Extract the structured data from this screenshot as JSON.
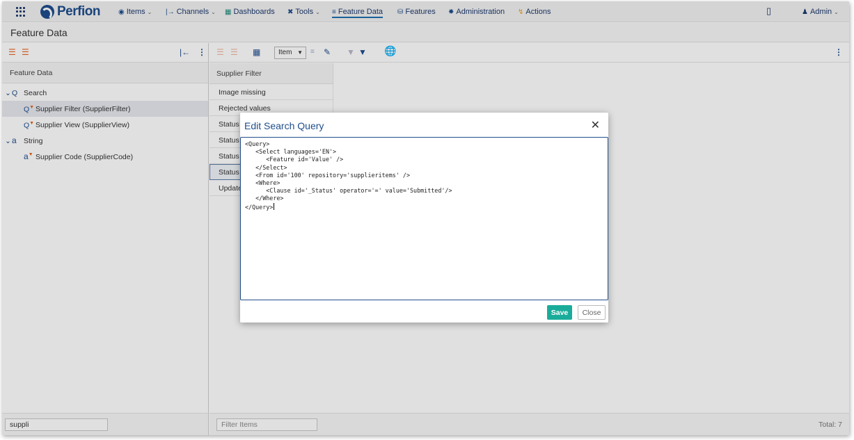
{
  "nav": {
    "logo": "Perfion",
    "items": [
      {
        "label": "Items",
        "icon": "items-icon",
        "caret": true
      },
      {
        "label": "Channels",
        "icon": "channels-icon",
        "caret": true
      },
      {
        "label": "Dashboards",
        "icon": "dashboards-icon",
        "caret": false
      },
      {
        "label": "Tools",
        "icon": "tools-icon",
        "caret": true
      },
      {
        "label": "Feature Data",
        "icon": "feature-data-icon",
        "caret": false
      },
      {
        "label": "Features",
        "icon": "features-icon",
        "caret": false
      },
      {
        "label": "Administration",
        "icon": "administration-icon",
        "caret": false
      },
      {
        "label": "Actions",
        "icon": "actions-icon",
        "caret": false
      }
    ],
    "user": "Admin"
  },
  "page": {
    "title": "Feature Data"
  },
  "left": {
    "header": "Feature Data",
    "tree": [
      {
        "label": "Search",
        "level": 0,
        "expanded": true,
        "icon": "search-icon"
      },
      {
        "label": "Supplier Filter (SupplierFilter)",
        "level": 1,
        "selected": true,
        "icon": "filter-feature-icon"
      },
      {
        "label": "Supplier View (SupplierView)",
        "level": 1,
        "icon": "filter-feature-icon"
      },
      {
        "label": "String",
        "level": 0,
        "expanded": true,
        "icon": "string-icon"
      },
      {
        "label": "Supplier Code (SupplierCode)",
        "level": 1,
        "icon": "string-feature-icon"
      }
    ],
    "search_value": "suppli"
  },
  "right": {
    "item_dropdown": "Item",
    "column_header": "Supplier Filter",
    "rows": [
      "Image missing",
      "Rejected values",
      "Status ",
      "Status ",
      "Status ",
      "Status ",
      "Update"
    ],
    "filter_placeholder": "Filter Items",
    "total": "Total: 7"
  },
  "modal": {
    "title": "Edit Search Query",
    "code_lines": [
      "<Query>",
      "   <Select languages='EN'>",
      "      <Feature id='Value' />",
      "   </Select>",
      "   <From id='100' repository='supplieritems' />",
      "   <Where>",
      "      <Clause id='_Status' operator='=' value='Submitted'/>",
      "   </Where>",
      "</Query>"
    ],
    "save_label": "Save",
    "close_label": "Close"
  },
  "colors": {
    "brand": "#1e4d8c",
    "save": "#1aac9a",
    "accent_orange": "#e8641e",
    "accent_teal": "#1a8a7a"
  }
}
